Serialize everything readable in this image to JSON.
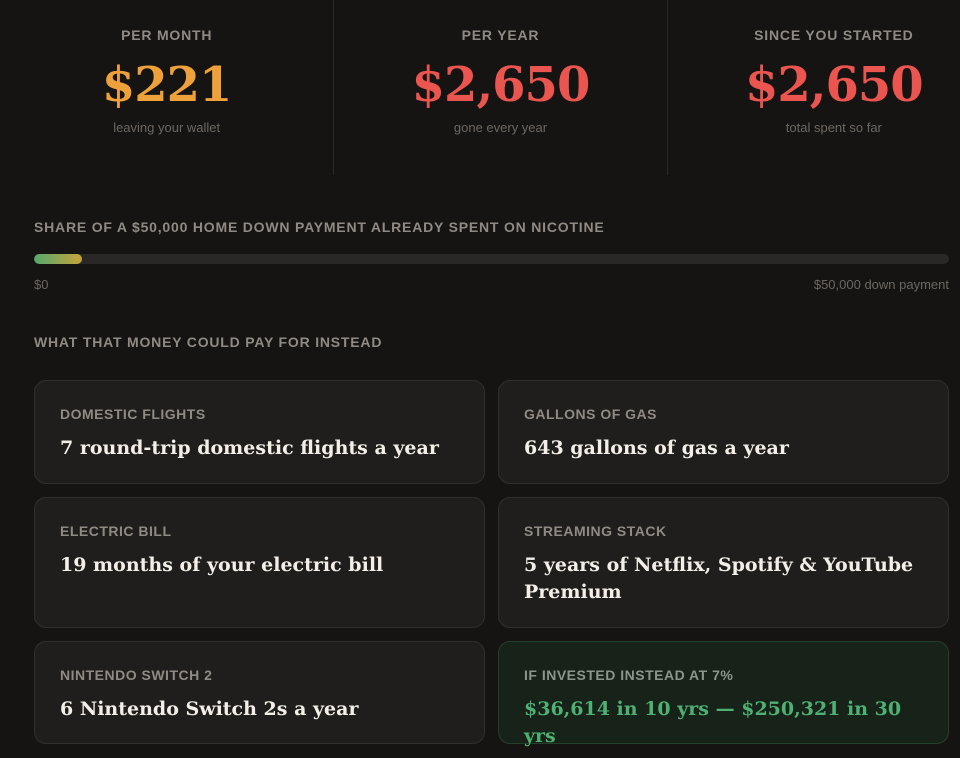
{
  "stats": [
    {
      "label": "PER MONTH",
      "value": "$221",
      "sub": "leaving your wallet",
      "color": "#eea13a"
    },
    {
      "label": "PER YEAR",
      "value": "$2,650",
      "sub": "gone every year",
      "color": "#ea5550"
    },
    {
      "label": "SINCE YOU STARTED",
      "value": "$2,650",
      "sub": "total spent so far",
      "color": "#ea5550"
    }
  ],
  "progress": {
    "label": "SHARE OF A $50,000 HOME DOWN PAYMENT ALREADY SPENT ON NICOTINE",
    "fraction": 0.053,
    "min_label": "$0",
    "max_label": "$50,000 down payment"
  },
  "alternatives": {
    "heading": "WHAT THAT MONEY COULD PAY FOR INSTEAD",
    "cards": [
      {
        "label": "DOMESTIC FLIGHTS",
        "text": "7 round-trip domestic flights a year"
      },
      {
        "label": "GALLONS OF GAS",
        "text": "643 gallons of gas a year"
      },
      {
        "label": "ELECTRIC BILL",
        "text": "19 months of your electric bill"
      },
      {
        "label": "STREAMING STACK",
        "text": "5 years of Netflix, Spotify & YouTube Premium"
      },
      {
        "label": "NINTENDO SWITCH 2",
        "text": "6 Nintendo Switch 2s a year"
      },
      {
        "label": "IF INVESTED INSTEAD AT 7%",
        "text": "$36,614 in 10 yrs — $250,321 in 30 yrs"
      }
    ]
  }
}
